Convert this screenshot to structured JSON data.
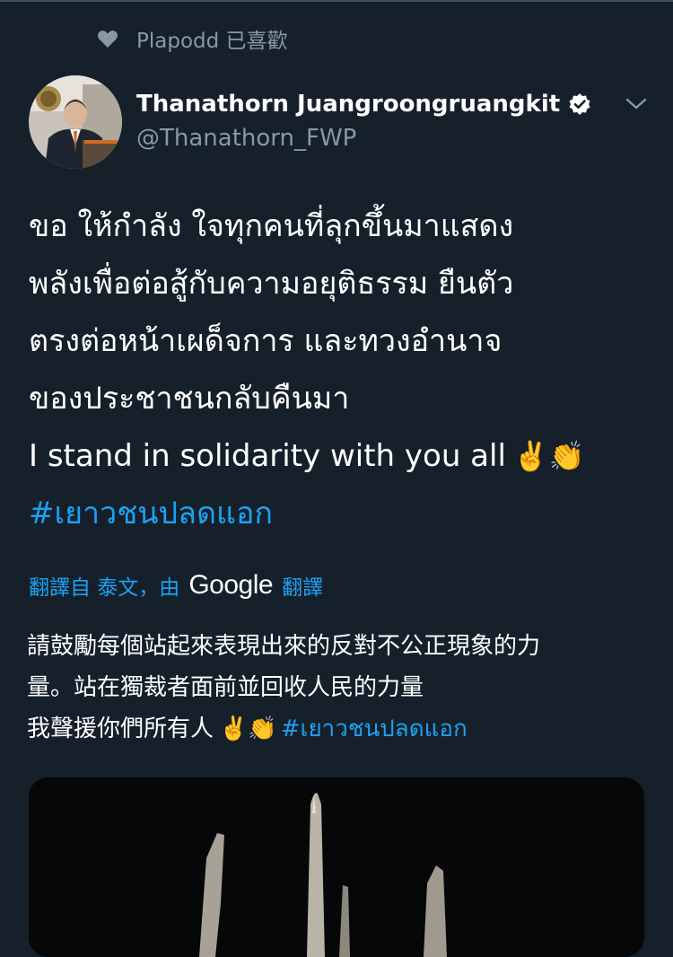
{
  "social_context": {
    "icon": "heart-icon",
    "text": "Plapodd 已喜歡"
  },
  "author": {
    "display_name": "Thanathorn Juangroongruangkit",
    "handle": "@Thanathorn_FWP",
    "verified_icon": "verified-badge-icon"
  },
  "tweet": {
    "lines": [
      "ขอ ให้กำลัง ใจทุกคนที่ลุกขึ้นมาแสดง",
      "พลังเพื่อต่อสู้กับความอยุติธรรม ยืนตัว",
      "ตรงต่อหน้าเผด็จการ และทวงอำนาจ",
      "ของประชาชนกลับคืนมา",
      "I stand in solidarity with you all"
    ],
    "emoji": "✌️👏",
    "hashtag": "#เยาวชนปลดแอก"
  },
  "translation_bar": {
    "prefix": "翻譯自 泰文，由",
    "provider": "Google",
    "suffix": "翻譯"
  },
  "translation": {
    "lines": [
      "請鼓勵每個站起來表現出來的反對不公正現象的力",
      "量。站在獨裁者面前並回收人民的力量",
      "我聲援你們所有人"
    ],
    "emoji": "✌️👏",
    "hashtag": "#เยาวชนปลดแอก"
  },
  "colors": {
    "background": "#15202b",
    "link": "#1da1f2",
    "secondary_text": "#8899a6"
  }
}
